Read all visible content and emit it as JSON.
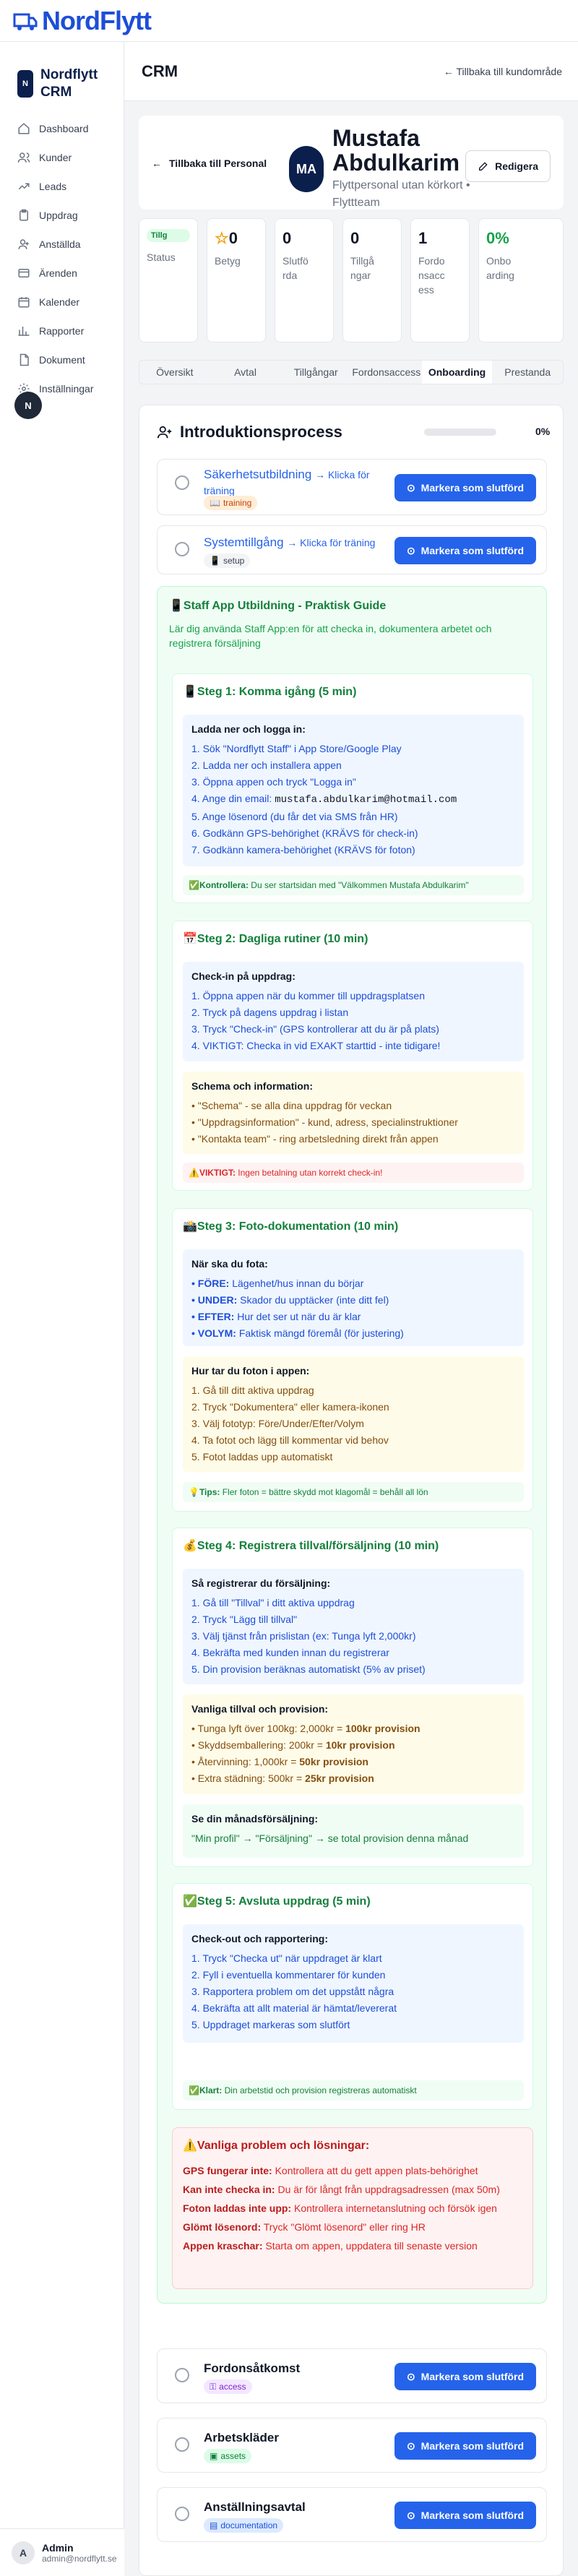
{
  "app": {
    "logo": "NordFlytt",
    "brand": "Nordflytt CRM",
    "brand_badge": "N"
  },
  "sidebar": {
    "items": [
      {
        "label": "Dashboard",
        "icon": "home-icon"
      },
      {
        "label": "Kunder",
        "icon": "users-icon"
      },
      {
        "label": "Leads",
        "icon": "trending-icon"
      },
      {
        "label": "Uppdrag",
        "icon": "clipboard-icon"
      },
      {
        "label": "Anställda",
        "icon": "user-icon"
      },
      {
        "label": "Ärenden",
        "icon": "ticket-icon"
      },
      {
        "label": "Kalender",
        "icon": "calendar-icon"
      },
      {
        "label": "Rapporter",
        "icon": "chart-icon"
      },
      {
        "label": "Dokument",
        "icon": "file-icon"
      },
      {
        "label": "Inställningar",
        "icon": "gear-icon"
      }
    ],
    "float_button": "N",
    "user": {
      "initial": "A",
      "name": "Admin",
      "email": "admin@nordflytt.se"
    }
  },
  "header": {
    "title": "CRM",
    "back": "← Tillbaka till kundområde"
  },
  "profile": {
    "back": "Tillbaka till Personal",
    "initials": "MA",
    "name": "Mustafa Abdulkarim",
    "role": "Flyttpersonal utan körkort • Flyttteam",
    "edit": "Redigera"
  },
  "stats": [
    {
      "value": "Tillg",
      "label": "Status"
    },
    {
      "value": "0",
      "label": "Betyg"
    },
    {
      "value": "0",
      "label": "Slutförda"
    },
    {
      "value": "0",
      "label": "Tillgångar"
    },
    {
      "value": "1",
      "label": "Fordonsaccess"
    },
    {
      "value": "0%",
      "label": "Onboarding"
    }
  ],
  "tabs": [
    "Översikt",
    "Avtal",
    "Tillgångar",
    "Fordonsaccess",
    "Onboarding",
    "Prestanda"
  ],
  "onboarding": {
    "title": "Introduktionsprocess",
    "progress_percent": 0,
    "progress_label": "0%",
    "mark_label": "Markera som slutförd",
    "tasks_top": [
      {
        "title": "Säkerhetsutbildning",
        "link": "→ Klicka för träning",
        "badge": "training"
      },
      {
        "title": "Systemtillgång",
        "link": "→ Klicka för träning",
        "badge": "setup"
      }
    ],
    "tasks_bottom": [
      {
        "title": "Fordonsåtkomst",
        "badge": "access"
      },
      {
        "title": "Arbetskläder",
        "badge": "assets"
      },
      {
        "title": "Anställningsavtal",
        "badge": "documentation"
      }
    ]
  },
  "guide": {
    "title": "📱Staff App Utbildning - Praktisk Guide",
    "desc": "Lär dig använda Staff App:en för att checka in, dokumentera arbetet och registrera försäljning",
    "step1": {
      "title": "📱Steg 1: Komma igång (5 min)",
      "h": "Ladda ner och logga in:",
      "lines": [
        "1. Sök \"Nordflytt Staff\" i App Store/Google Play",
        "2. Ladda ner och installera appen",
        "3. Öppna appen och tryck \"Logga in\"",
        "4. Ange din email: ",
        "5. Ange lösenord (du får det via SMS från HR)",
        "6. Godkänn GPS-behörighet (KRÄVS för check-in)",
        "7. Godkänn kamera-behörighet (KRÄVS för foton)"
      ],
      "email": "mustafa.abdulkarim@hotmail.com",
      "check_label": "✅Kontrollera:",
      "check": " Du ser startsidan med \"Välkommen Mustafa Abdulkarim\""
    },
    "step2": {
      "title": "📅Steg 2: Dagliga rutiner (10 min)",
      "h1": "Check-in på uppdrag:",
      "lines1": [
        "1. Öppna appen när du kommer till uppdragsplatsen",
        "2. Tryck på dagens uppdrag i listan",
        "3. Tryck \"Check-in\" (GPS kontrollerar att du är på plats)",
        "4. VIKTIGT: Checka in vid EXAKT starttid - inte tidigare!"
      ],
      "h2": "Schema och information:",
      "lines2": [
        "• \"Schema\" - se alla dina uppdrag för veckan",
        "• \"Uppdragsinformation\" - kund, adress, specialinstruktioner",
        "• \"Kontakta team\" - ring arbetsledning direkt från appen"
      ],
      "warn_label": "⚠️VIKTIGT:",
      "warn": " Ingen betalning utan korrekt check-in!"
    },
    "step3": {
      "title": "📸Steg 3: Foto-dokumentation (10 min)",
      "h1": "När ska du fota:",
      "items1": [
        {
          "k": "• FÖRE:",
          "v": " Lägenhet/hus innan du börjar"
        },
        {
          "k": "• UNDER:",
          "v": " Skador du upptäcker (inte ditt fel)"
        },
        {
          "k": "• EFTER:",
          "v": " Hur det ser ut när du är klar"
        },
        {
          "k": "• VOLYM:",
          "v": " Faktisk mängd föremål (för justering)"
        }
      ],
      "h2": "Hur tar du foton i appen:",
      "lines2": [
        "1. Gå till ditt aktiva uppdrag",
        "2. Tryck \"Dokumentera\" eller kamera-ikonen",
        "3. Välj fototyp: Före/Under/Efter/Volym",
        "4. Ta fotot och lägg till kommentar vid behov",
        "5. Fotot laddas upp automatiskt"
      ],
      "tip_label": "💡Tips:",
      "tip": " Fler foton = bättre skydd mot klagomål = behåll all lön"
    },
    "step4": {
      "title": "💰Steg 4: Registrera tillval/försäljning (10 min)",
      "h1": "Så registrerar du försäljning:",
      "lines1": [
        "1. Gå till \"Tillval\" i ditt aktiva uppdrag",
        "2. Tryck \"Lägg till tillval\"",
        "3. Välj tjänst från prislistan (ex: Tunga lyft 2,000kr)",
        "4. Bekräfta med kunden innan du registrerar",
        "5. Din provision beräknas automatiskt (5% av priset)"
      ],
      "h2": "Vanliga tillval och provision:",
      "items2": [
        {
          "k": "• Tunga lyft över 100kg: 2,000kr = ",
          "v": "100kr provision"
        },
        {
          "k": "• Skyddsemballering: 200kr = ",
          "v": "10kr provision"
        },
        {
          "k": "• Återvinning: 1,000kr = ",
          "v": "50kr provision"
        },
        {
          "k": "• Extra städning: 500kr = ",
          "v": "25kr provision"
        }
      ],
      "h3": "Se din månadsförsäljning:",
      "line3": "\"Min profil\" → \"Försäljning\" → se total provision denna månad"
    },
    "step5": {
      "title": "✅Steg 5: Avsluta uppdrag (5 min)",
      "h": "Check-out och rapportering:",
      "lines": [
        "1. Tryck \"Checka ut\" när uppdraget är klart",
        "2. Fyll i eventuella kommentarer för kunden",
        "3. Rapportera problem om det uppstått några",
        "4. Bekräfta att allt material är hämtat/levererat",
        "5. Uppdraget markeras som slutfört"
      ],
      "done_label": "✅Klart:",
      "done": " Din arbetstid och provision registreras automatiskt"
    },
    "problems": {
      "title": "⚠️Vanliga problem och lösningar:",
      "items": [
        {
          "k": "GPS fungerar inte:",
          "v": " Kontrollera att du gett appen plats-behörighet"
        },
        {
          "k": "Kan inte checka in:",
          "v": " Du är för långt från uppdragsadressen (max 50m)"
        },
        {
          "k": "Foton laddas inte upp:",
          "v": " Kontrollera internetanslutning och försök igen"
        },
        {
          "k": "Glömt lösenord:",
          "v": " Tryck \"Glömt lösenord\" eller ring HR"
        },
        {
          "k": "Appen kraschar:",
          "v": " Starta om appen, uppdatera till senaste version"
        }
      ]
    }
  },
  "colors": {
    "accent": "#2563eb",
    "brand": "#0b1f4d",
    "green": "#15803d"
  }
}
